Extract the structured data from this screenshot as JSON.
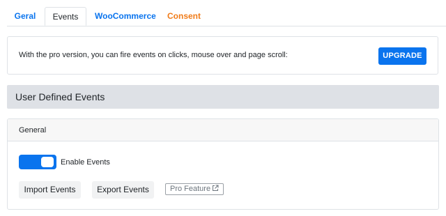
{
  "tabs": [
    {
      "label": "Geral",
      "color": "#0a74ee"
    },
    {
      "label": "Events",
      "color": "#212529",
      "active": true
    },
    {
      "label": "WooCommerce",
      "color": "#0a74ee"
    },
    {
      "label": "Consent",
      "color": "#f07c1a"
    }
  ],
  "upgrade": {
    "text": "With the pro version, you can fire events on clicks, mouse over and page scroll:",
    "button_label": "UPGRADE"
  },
  "section": {
    "title": "User Defined Events"
  },
  "general": {
    "title": "General",
    "toggle_label": "Enable Events",
    "toggle_on": true,
    "import_label": "Import Events",
    "export_label": "Export Events",
    "pro_badge_label": "Pro Feature",
    "pro_badge_icon": "external-link-icon"
  },
  "colors": {
    "primary": "#0a74ee",
    "consent": "#f07c1a"
  }
}
